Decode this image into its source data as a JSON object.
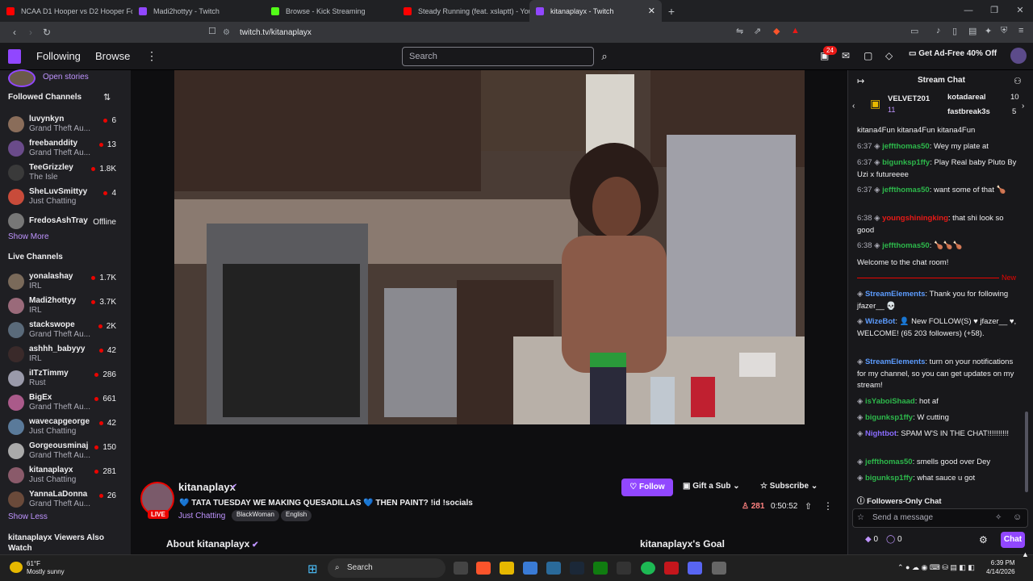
{
  "tabs": [
    {
      "title": "NCAA D1 Hooper vs D2 Hooper For",
      "color": "#ff0000"
    },
    {
      "title": "Madi2hottyy - Twitch",
      "color": "#9147ff"
    },
    {
      "title": "Browse - Kick Streaming",
      "color": "#53fc18"
    },
    {
      "title": "Steady Running (feat. xslaptt) - YouTu",
      "color": "#ff0000"
    },
    {
      "title": "kitanaplayx - Twitch",
      "color": "#9147ff",
      "active": true
    }
  ],
  "address": {
    "url": "twitch.tv/kitanaplayx"
  },
  "topnav": {
    "following": "Following",
    "browse": "Browse",
    "search_placeholder": "Search",
    "notif_count": "24",
    "adfree": "Get Ad-Free 40% Off"
  },
  "sidebar": {
    "open_stories": "Open stories",
    "followed_title": "Followed Channels",
    "followed": [
      {
        "name": "luvynkyn",
        "game": "Grand Theft Au...",
        "viewers": "6",
        "color": "#8a6d5a"
      },
      {
        "name": "freebanddity",
        "game": "Grand Theft Au...",
        "viewers": "13",
        "color": "#6a4b8a"
      },
      {
        "name": "TeeGrizzley",
        "game": "The Isle",
        "viewers": "1.8K",
        "color": "#3a3a3a"
      },
      {
        "name": "SheLuvSmittyy",
        "game": "Just Chatting",
        "viewers": "4",
        "color": "#c84b3a"
      },
      {
        "name": "FredosAshTray",
        "game": "",
        "viewers": "Offline",
        "color": "#777777"
      }
    ],
    "show_more": "Show More",
    "live_title": "Live Channels",
    "live": [
      {
        "name": "yonalashay",
        "game": "IRL",
        "viewers": "1.7K",
        "color": "#7a6a5a"
      },
      {
        "name": "Madi2hottyy",
        "game": "IRL",
        "viewers": "3.7K",
        "color": "#9a6a7a"
      },
      {
        "name": "stackswope",
        "game": "Grand Theft Au...",
        "viewers": "2K",
        "color": "#5a6a7a"
      },
      {
        "name": "ashhh_babyyy",
        "game": "IRL",
        "viewers": "42",
        "color": "#3a2a2a"
      },
      {
        "name": "iITzTimmy",
        "game": "Rust",
        "viewers": "286",
        "color": "#9a9aaa"
      },
      {
        "name": "BigEx",
        "game": "Grand Theft Au...",
        "viewers": "661",
        "color": "#aa5a8a"
      },
      {
        "name": "wavecapgeorge",
        "game": "Just Chatting",
        "viewers": "42",
        "color": "#5a7a9a"
      },
      {
        "name": "Gorgeousminaj",
        "game": "Grand Theft Au...",
        "viewers": "150",
        "color": "#aaaaaa"
      },
      {
        "name": "kitanaplayx",
        "game": "Just Chatting",
        "viewers": "281",
        "color": "#8a5a6a"
      },
      {
        "name": "YannaLaDonna",
        "game": "Grand Theft Au...",
        "viewers": "26",
        "color": "#6a4a3a"
      }
    ],
    "show_less": "Show Less",
    "also_watch": "kitanaplayx Viewers Also Watch"
  },
  "stream": {
    "channel": "kitanaplayx",
    "live": "LIVE",
    "title": "💙 TATA TUESDAY WE MAKING QUESADILLAS 💙 THEN PAINT? !id !socials",
    "category": "Just Chatting",
    "tags": [
      "BlackWoman",
      "English"
    ],
    "follow": "Follow",
    "gift": "Gift a Sub",
    "subscribe": "Subscribe",
    "viewers": "281",
    "uptime": "0:50:52",
    "about": "About kitanaplayx",
    "goal": "kitanaplayx's Goal"
  },
  "chat": {
    "title": "Stream Chat",
    "gifters": [
      {
        "name": "VELVET201",
        "count": "11"
      },
      {
        "name": "kotadareal",
        "count": "10"
      },
      {
        "name": "fastbreak3s",
        "count": "5"
      }
    ],
    "messages": [
      {
        "time": "",
        "user": "",
        "color": "#efeff1",
        "text": "kitana4Fun kitana4Fun kitana4Fun"
      },
      {
        "time": "6:37",
        "user": "jeffthomas50",
        "color": "#2db84b",
        "text": ": Wey my plate at"
      },
      {
        "time": "6:37",
        "user": "bigunksp1ffy",
        "color": "#2db84b",
        "text": ": Play Real baby Pluto By Uzi x futureeee"
      },
      {
        "time": "6:37",
        "user": "jeffthomas50",
        "color": "#2db84b",
        "text": ": want some of that 🍗"
      },
      {
        "time": "6:38",
        "user": "youngshiningking",
        "color": "#e91916",
        "text": ": that shi look so good"
      },
      {
        "time": "6:38",
        "user": "jeffthomas50",
        "color": "#2db84b",
        "text": ": 🍗🍗🍗"
      },
      {
        "time": "",
        "user": "",
        "color": "#efeff1",
        "text": "Welcome to the chat room!"
      },
      {
        "time": "",
        "user": "StreamElements",
        "color": "#5c9cff",
        "text": ": Thank you for following jfazer__ 💀"
      },
      {
        "time": "",
        "user": "WizeBot",
        "color": "#5c9cff",
        "text": ": 👤 New FOLLOW(S) ♥ jfazer__ ♥, WELCOME! (65 203 followers) (+58)."
      },
      {
        "time": "",
        "user": "StreamElements",
        "color": "#5c9cff",
        "text": ": turn on your notifications for my channel, so you can get updates on my stream!"
      },
      {
        "time": "",
        "user": "isYaboiShaad",
        "color": "#2db84b",
        "text": ": hot af"
      },
      {
        "time": "",
        "user": "bigunksp1ffy",
        "color": "#2db84b",
        "text": ": W cutting"
      },
      {
        "time": "",
        "user": "Nightbot",
        "color": "#8a6cff",
        "text": ": SPAM W'S IN THE CHAT!!!!!!!!!!"
      },
      {
        "time": "",
        "user": "jeffthomas50",
        "color": "#2db84b",
        "text": ": smells good over Dey"
      },
      {
        "time": "",
        "user": "bigunksp1ffy",
        "color": "#2db84b",
        "text": ": what sauce u got"
      }
    ],
    "new_label": "New",
    "followers_only": "Followers-Only Chat",
    "placeholder": "Send a message",
    "points": "0",
    "points2": "0",
    "send": "Chat"
  },
  "taskbar": {
    "temp": "61°F",
    "weather": "Mostly sunny",
    "search": "Search",
    "time": "6:39 PM",
    "date": "4/14/2026"
  }
}
